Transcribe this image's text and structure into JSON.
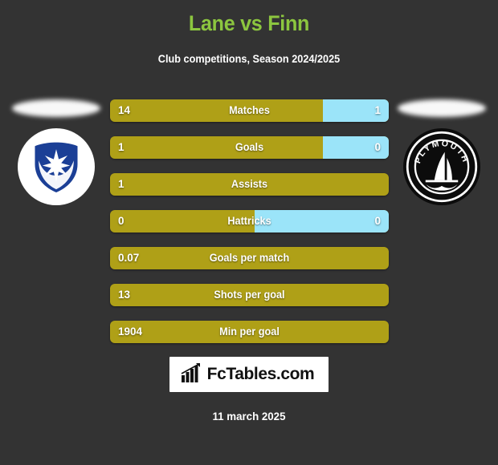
{
  "header": {
    "title": "Lane vs Finn",
    "subtitle": "Club competitions, Season 2024/2025",
    "title_color": "#8CC63F",
    "subtitle_color": "#FFFFFF"
  },
  "colors": {
    "background": "#333333",
    "home_bar": "#AFA017",
    "away_bar": "#9BE4F9",
    "text": "#FFFFFF"
  },
  "teams": {
    "home": {
      "name": "Portsmouth",
      "crest": "portsmouth-crest-icon"
    },
    "away": {
      "name": "Plymouth",
      "crest": "plymouth-crest-icon",
      "crest_text": "PLYMOUTH"
    }
  },
  "chart_data": {
    "type": "bar",
    "title": "Lane vs Finn",
    "subtitle": "Club competitions, Season 2024/2025",
    "orientation": "horizontal-diverging",
    "series": [
      {
        "name": "Lane",
        "side": "left",
        "color": "#AFA017"
      },
      {
        "name": "Finn",
        "side": "right",
        "color": "#9BE4F9"
      }
    ],
    "categories": [
      "Matches",
      "Goals",
      "Assists",
      "Hattricks",
      "Goals per match",
      "Shots per goal",
      "Min per goal"
    ],
    "rows": [
      {
        "label": "Matches",
        "left_value": "14",
        "right_value": "1",
        "left_pct": 76.5
      },
      {
        "label": "Goals",
        "left_value": "1",
        "right_value": "0",
        "left_pct": 76.5
      },
      {
        "label": "Assists",
        "left_value": "1",
        "right_value": "",
        "left_pct": 100
      },
      {
        "label": "Hattricks",
        "left_value": "0",
        "right_value": "0",
        "left_pct": 52
      },
      {
        "label": "Goals per match",
        "left_value": "0.07",
        "right_value": "",
        "left_pct": 100
      },
      {
        "label": "Shots per goal",
        "left_value": "13",
        "right_value": "",
        "left_pct": 100
      },
      {
        "label": "Min per goal",
        "left_value": "1904",
        "right_value": "",
        "left_pct": 100
      }
    ]
  },
  "footer": {
    "brand": "FcTables.com",
    "brand_icon": "bar-chart-icon",
    "date": "11 march 2025"
  }
}
